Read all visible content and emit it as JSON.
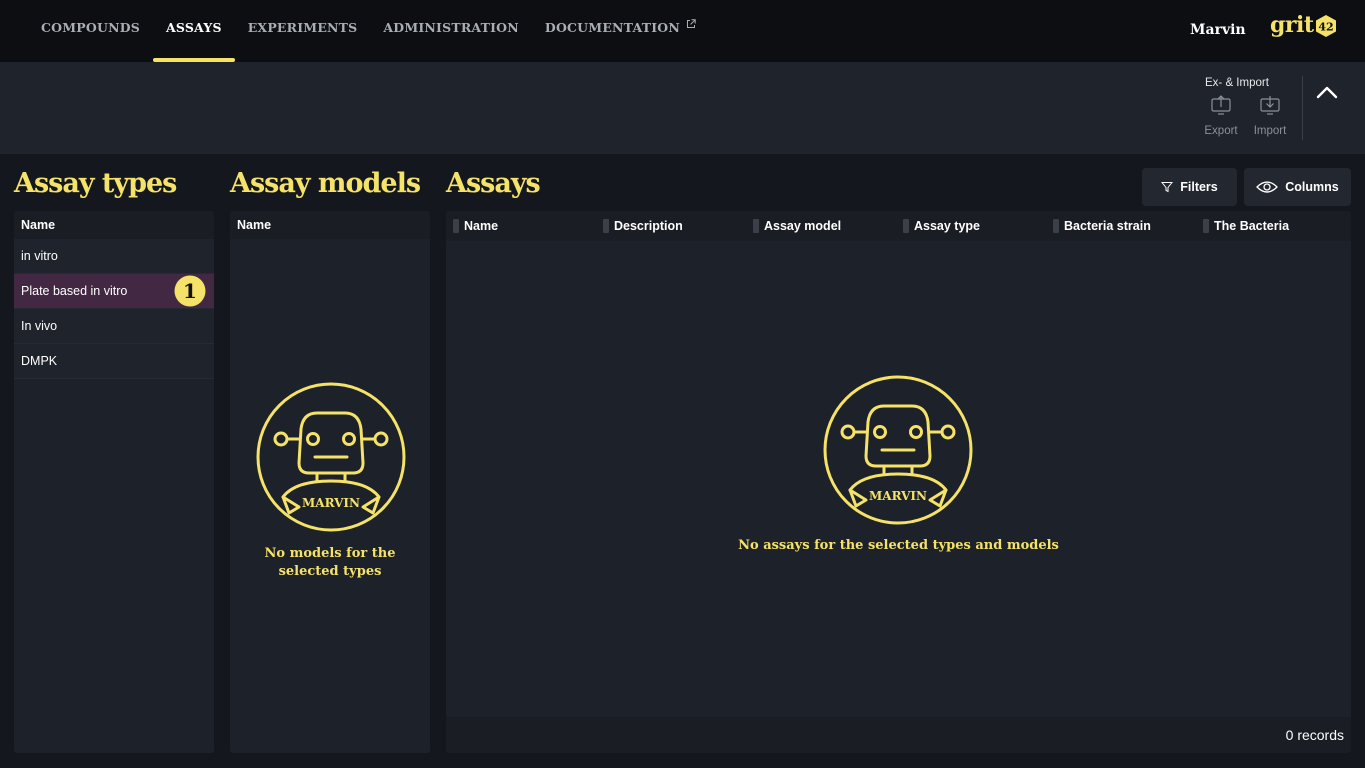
{
  "nav": {
    "items": [
      "COMPOUNDS",
      "ASSAYS",
      "EXPERIMENTS",
      "ADMINISTRATION",
      "DOCUMENTATION"
    ],
    "active": "ASSAYS"
  },
  "user": {
    "name": "Marvin"
  },
  "logo": {
    "text": "grit",
    "badge": "42"
  },
  "export_import": {
    "title": "Ex- & Import",
    "export_label": "Export",
    "import_label": "Import"
  },
  "assay_types": {
    "title": "Assay types",
    "column": "Name",
    "rows": [
      "in vitro",
      "Plate based in vitro",
      "In vivo",
      "DMPK"
    ],
    "selected_index": 1,
    "step_badge": "1"
  },
  "assay_models": {
    "title": "Assay models",
    "column": "Name",
    "empty_line1": "No models for the",
    "empty_line2": "selected types",
    "mascot_label": "MARVIN"
  },
  "assays": {
    "title": "Assays",
    "filters_label": "Filters",
    "columns_label": "Columns",
    "columns": [
      "Name",
      "Description",
      "Assay model",
      "Assay type",
      "Bacteria strain",
      "The Bacteria"
    ],
    "empty_text": "No assays for the selected types and models",
    "mascot_label": "MARVIN",
    "records": "0 records"
  },
  "colors": {
    "accent": "#f5e268",
    "selected_row": "#432843",
    "background": "#14171d"
  }
}
